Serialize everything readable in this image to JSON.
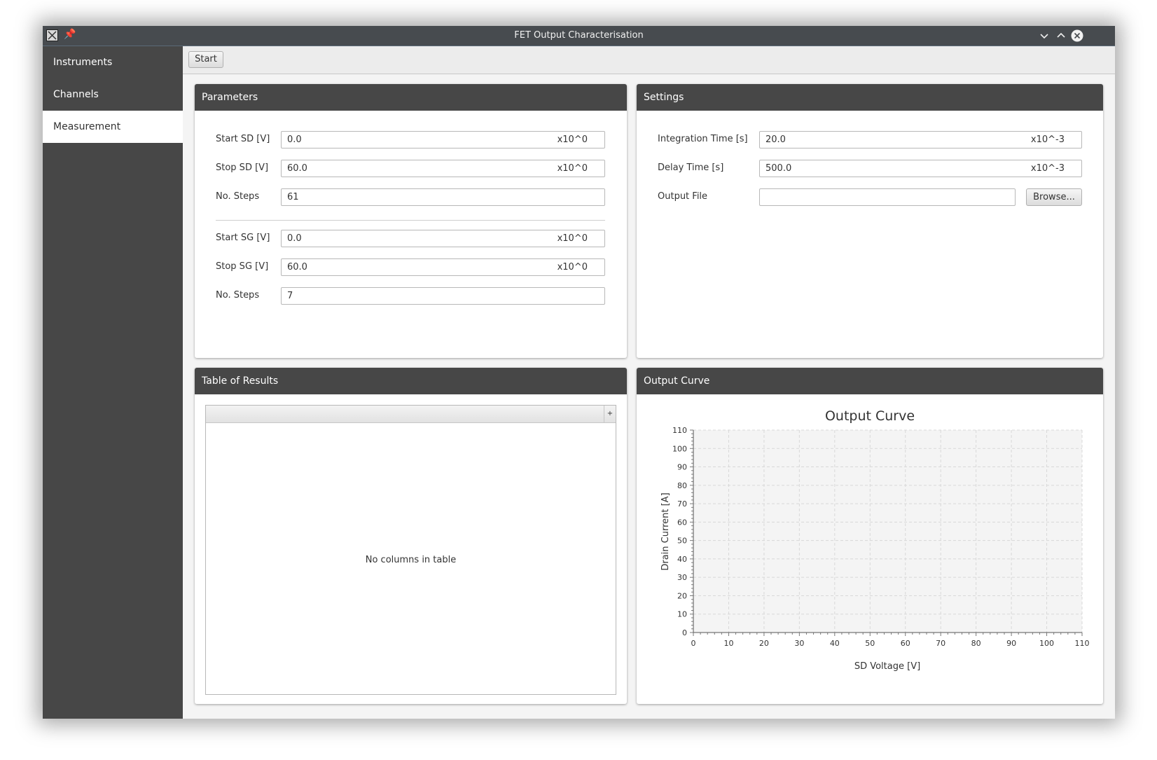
{
  "window": {
    "title": "FET Output Characterisation",
    "titlebar_bg": "#474b4f"
  },
  "sidebar": {
    "items": [
      {
        "label": "Instruments",
        "active": false
      },
      {
        "label": "Channels",
        "active": false
      },
      {
        "label": "Measurement",
        "active": true
      }
    ]
  },
  "toolbar": {
    "start_label": "Start"
  },
  "parameters": {
    "header": "Parameters",
    "start_sd": {
      "label": "Start SD [V]",
      "value": "0.0",
      "unit": "x10^0"
    },
    "stop_sd": {
      "label": "Stop SD [V]",
      "value": "60.0",
      "unit": "x10^0"
    },
    "sd_steps": {
      "label": "No. Steps",
      "value": "61"
    },
    "start_sg": {
      "label": "Start SG [V]",
      "value": "0.0",
      "unit": "x10^0"
    },
    "stop_sg": {
      "label": "Stop SG [V]",
      "value": "60.0",
      "unit": "x10^0"
    },
    "sg_steps": {
      "label": "No. Steps",
      "value": "7"
    }
  },
  "settings": {
    "header": "Settings",
    "integration_time": {
      "label": "Integration Time [s]",
      "value": "20.0",
      "unit": "x10^-3"
    },
    "delay_time": {
      "label": "Delay Time [s]",
      "value": "500.0",
      "unit": "x10^-3"
    },
    "output_file": {
      "label": "Output File",
      "value": ""
    },
    "browse_label": "Browse..."
  },
  "results": {
    "header": "Table of Results",
    "empty_text": "No columns in table"
  },
  "output_curve": {
    "header": "Output Curve"
  },
  "chart_data": {
    "type": "scatter",
    "title": "Output Curve",
    "xlabel": "SD Voltage [V]",
    "ylabel": "Drain Current [A]",
    "xlim": [
      0,
      110
    ],
    "ylim": [
      0,
      110
    ],
    "x_ticks": [
      "0",
      "10",
      "20",
      "30",
      "40",
      "50",
      "60",
      "70",
      "80",
      "90",
      "100",
      "110"
    ],
    "y_ticks": [
      "0",
      "10",
      "20",
      "30",
      "40",
      "50",
      "60",
      "70",
      "80",
      "90",
      "100",
      "110"
    ],
    "grid": true,
    "series": []
  }
}
